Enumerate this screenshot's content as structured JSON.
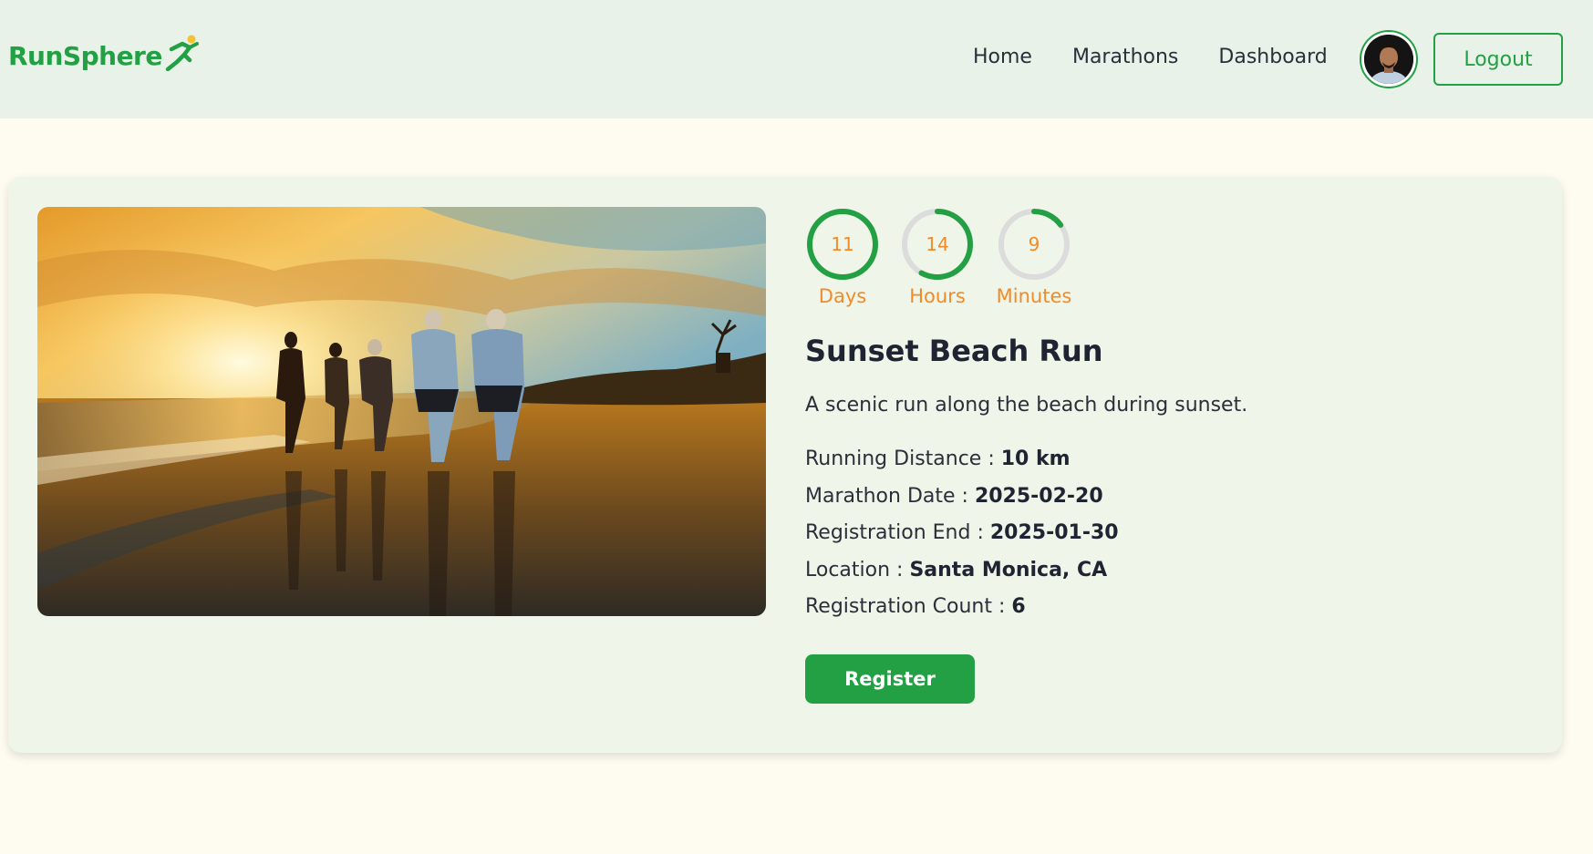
{
  "brand": {
    "name": "RunSphere",
    "color": "#22a043"
  },
  "nav": {
    "links": [
      "Home",
      "Marathons",
      "Dashboard"
    ],
    "logout_label": "Logout"
  },
  "countdown": {
    "days": {
      "value": "11",
      "label": "Days",
      "fraction": 1.0
    },
    "hours": {
      "value": "14",
      "label": "Hours",
      "fraction": 0.58
    },
    "minutes": {
      "value": "9",
      "label": "Minutes",
      "fraction": 0.15
    }
  },
  "event": {
    "title": "Sunset Beach Run",
    "description": "A scenic run along the beach during sunset.",
    "details": [
      {
        "label": "Running Distance : ",
        "value": "10 km"
      },
      {
        "label": "Marathon Date : ",
        "value": "2025-02-20"
      },
      {
        "label": "Registration End : ",
        "value": "2025-01-30"
      },
      {
        "label": "Location : ",
        "value": "Santa Monica, CA"
      },
      {
        "label": "Registration Count : ",
        "value": "6"
      }
    ],
    "register_label": "Register"
  },
  "colors": {
    "accent": "#22a043",
    "timer": "#f28b27",
    "ring_track": "#dcdcdc"
  }
}
